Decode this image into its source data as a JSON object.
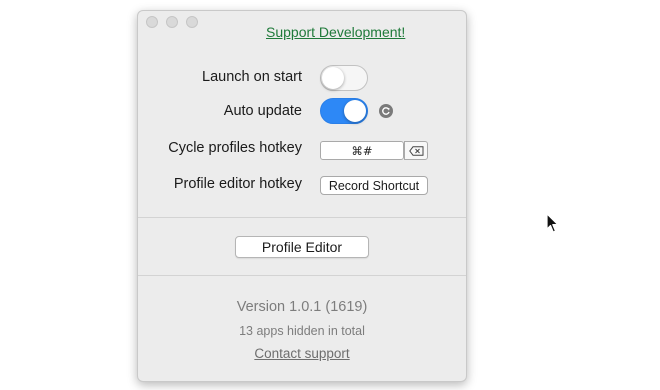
{
  "header": {
    "support_link": "Support Development!"
  },
  "settings": {
    "launch_on_start": {
      "label": "Launch on start",
      "enabled": false
    },
    "auto_update": {
      "label": "Auto update",
      "enabled": true
    },
    "cycle_profiles_hotkey": {
      "label": "Cycle profiles hotkey",
      "value": "⌘#"
    },
    "profile_editor_hotkey": {
      "label": "Profile editor hotkey",
      "button_label": "Record Shortcut"
    }
  },
  "actions": {
    "profile_editor_button": "Profile Editor"
  },
  "footer": {
    "version": "Version 1.0.1 (1619)",
    "apps_hidden": "13 apps hidden in total",
    "contact_support": "Contact support"
  },
  "colors": {
    "toggle_on": "#2d88f6",
    "link_green": "#1f7a3a",
    "window_bg": "#ececec"
  },
  "icons": {
    "refresh": "refresh-icon",
    "clear": "clear-shortcut-icon",
    "cursor": "mouse-pointer-icon"
  }
}
